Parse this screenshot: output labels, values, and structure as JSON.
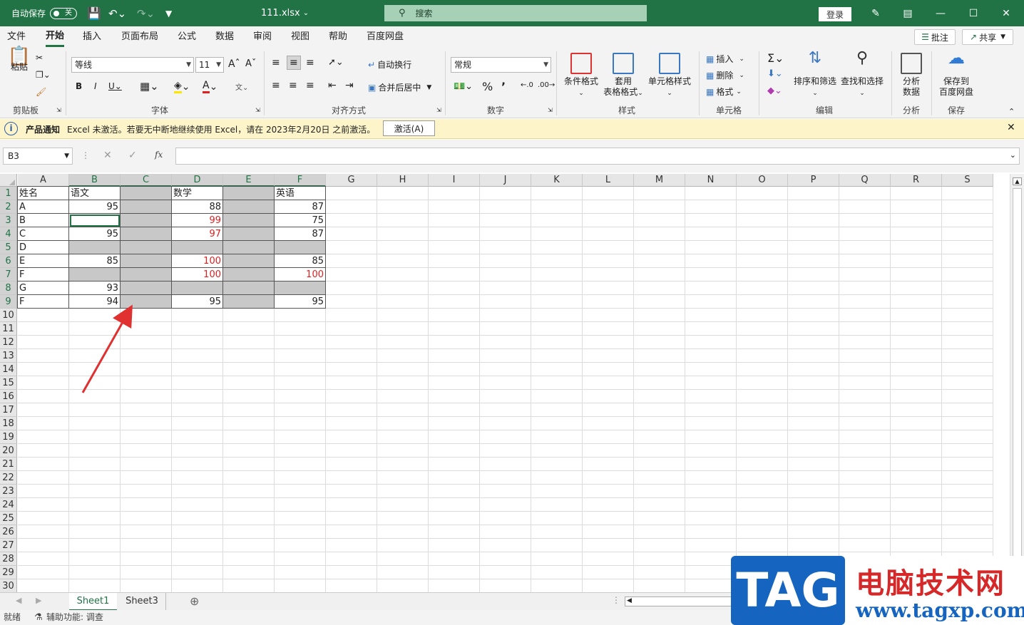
{
  "title_bar": {
    "autosave_label": "自动保存",
    "autosave_state": "关",
    "filename": "111.xlsx",
    "search_placeholder": "搜索",
    "login_label": "登录"
  },
  "menu": {
    "items": [
      "文件",
      "开始",
      "插入",
      "页面布局",
      "公式",
      "数据",
      "审阅",
      "视图",
      "帮助",
      "百度网盘"
    ],
    "active": "开始",
    "comments_label": "批注",
    "share_label": "共享"
  },
  "ribbon": {
    "clipboard": {
      "paste_label": "粘贴",
      "group_label": "剪贴板"
    },
    "font": {
      "font_name": "等线",
      "font_size": "11",
      "group_label": "字体"
    },
    "alignment": {
      "wrap_label": "自动换行",
      "merge_label": "合并后居中",
      "group_label": "对齐方式"
    },
    "number": {
      "format": "常规",
      "group_label": "数字"
    },
    "styles": {
      "conditional_label": "条件格式",
      "table_label_1": "套用",
      "table_label_2": "表格格式",
      "cell_styles_label": "单元格样式",
      "group_label": "样式"
    },
    "cells": {
      "insert_label": "插入",
      "delete_label": "删除",
      "format_label": "格式",
      "group_label": "单元格"
    },
    "editing": {
      "sort_label": "排序和筛选",
      "find_label": "查找和选择",
      "group_label": "编辑"
    },
    "analysis": {
      "label_1": "分析",
      "label_2": "数据",
      "group_label": "分析"
    },
    "save": {
      "label_1": "保存到",
      "label_2": "百度网盘",
      "group_label": "保存"
    }
  },
  "notice": {
    "title": "产品通知",
    "message": "Excel 未激活。若要无中断地继续使用 Excel，请在 2023年2月20日 之前激活。",
    "button": "激活(A)"
  },
  "formula_bar": {
    "name_box": "B3",
    "fx_label": "fx",
    "content": ""
  },
  "columns": [
    "A",
    "B",
    "C",
    "D",
    "E",
    "F",
    "G",
    "H",
    "I",
    "J",
    "K",
    "L",
    "M",
    "N",
    "O",
    "P",
    "Q",
    "R",
    "S"
  ],
  "rows": [
    "1",
    "2",
    "3",
    "4",
    "5",
    "6",
    "7",
    "8",
    "9",
    "10",
    "11",
    "12",
    "13",
    "14",
    "15",
    "16",
    "17",
    "18",
    "19",
    "20",
    "21",
    "22",
    "23",
    "24",
    "25",
    "26",
    "27",
    "28",
    "29",
    "30"
  ],
  "table": [
    [
      "姓名",
      "语文",
      "",
      "数学",
      "",
      "英语"
    ],
    [
      "A",
      "95",
      "",
      "88",
      "",
      "87"
    ],
    [
      "B",
      "",
      "",
      "99",
      "",
      "75"
    ],
    [
      "C",
      "95",
      "",
      "97",
      "",
      "87"
    ],
    [
      "D",
      "",
      "",
      "",
      "",
      ""
    ],
    [
      "E",
      "85",
      "",
      "100",
      "",
      "85"
    ],
    [
      "F",
      "",
      "",
      "100",
      "",
      "100"
    ],
    [
      "G",
      "93",
      "",
      "",
      "",
      ""
    ],
    [
      "F",
      "94",
      "",
      "95",
      "",
      "95"
    ]
  ],
  "sheets": {
    "tabs": [
      "Sheet1",
      "Sheet3"
    ],
    "active": "Sheet1"
  },
  "status": {
    "ready": "就绪",
    "accessibility": "辅助功能: 调查"
  },
  "watermark": {
    "tag": "TAG",
    "cn": "电脑技术网",
    "url": "www.tagxp.com"
  },
  "colors": {
    "accent": "#217346",
    "red_value": "#e02020",
    "grey_fill": "#c8c8c8",
    "notice_bg": "#fdf5c9"
  }
}
